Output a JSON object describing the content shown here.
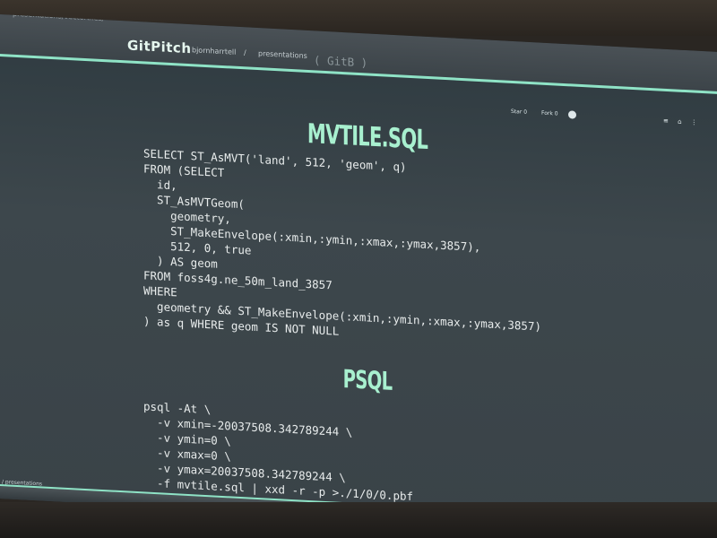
{
  "browser": {
    "url": "presentations/vectortiles/"
  },
  "header": {
    "brand": "GitPitch",
    "user": "bjornharrtell",
    "separator": "/",
    "section": "presentations",
    "code_tag": "( GitB )"
  },
  "toolbar": {
    "star_label": "Star 0",
    "fork_label": "Fork 0",
    "github_icon": "github-icon",
    "menu_icons": "≡ ⌂ ⋮"
  },
  "slide": {
    "title_1": "MVTILE.SQL",
    "code_1": "SELECT ST_AsMVT('land', 512, 'geom', q)\nFROM (SELECT\n  id,\n  ST_AsMVTGeom(\n    geometry,\n    ST_MakeEnvelope(:xmin,:ymin,:xmax,:ymax,3857),\n    512, 0, true\n  ) AS geom\nFROM foss4g.ne_50m_land_3857\nWHERE\n  geometry && ST_MakeEnvelope(:xmin,:ymin,:xmax,:ymax,3857)\n) as q WHERE geom IS NOT NULL",
    "title_2": "PSQL",
    "code_2": "psql -At \\\n  -v xmin=-20037508.342789244 \\\n  -v ymin=0 \\\n  -v xmax=0 \\\n  -v ymax=20037508.342789244 \\\n  -f mvtile.sql | xxd -r -p >./1/0/0.pbf"
  },
  "footer": {
    "status": "/ presentations",
    "nav": "◀ ▶"
  },
  "colors": {
    "accent": "#8fe3c6",
    "title": "#a8f0cf",
    "code_text": "#e8ecec",
    "slide_bg": "#3d474c"
  }
}
